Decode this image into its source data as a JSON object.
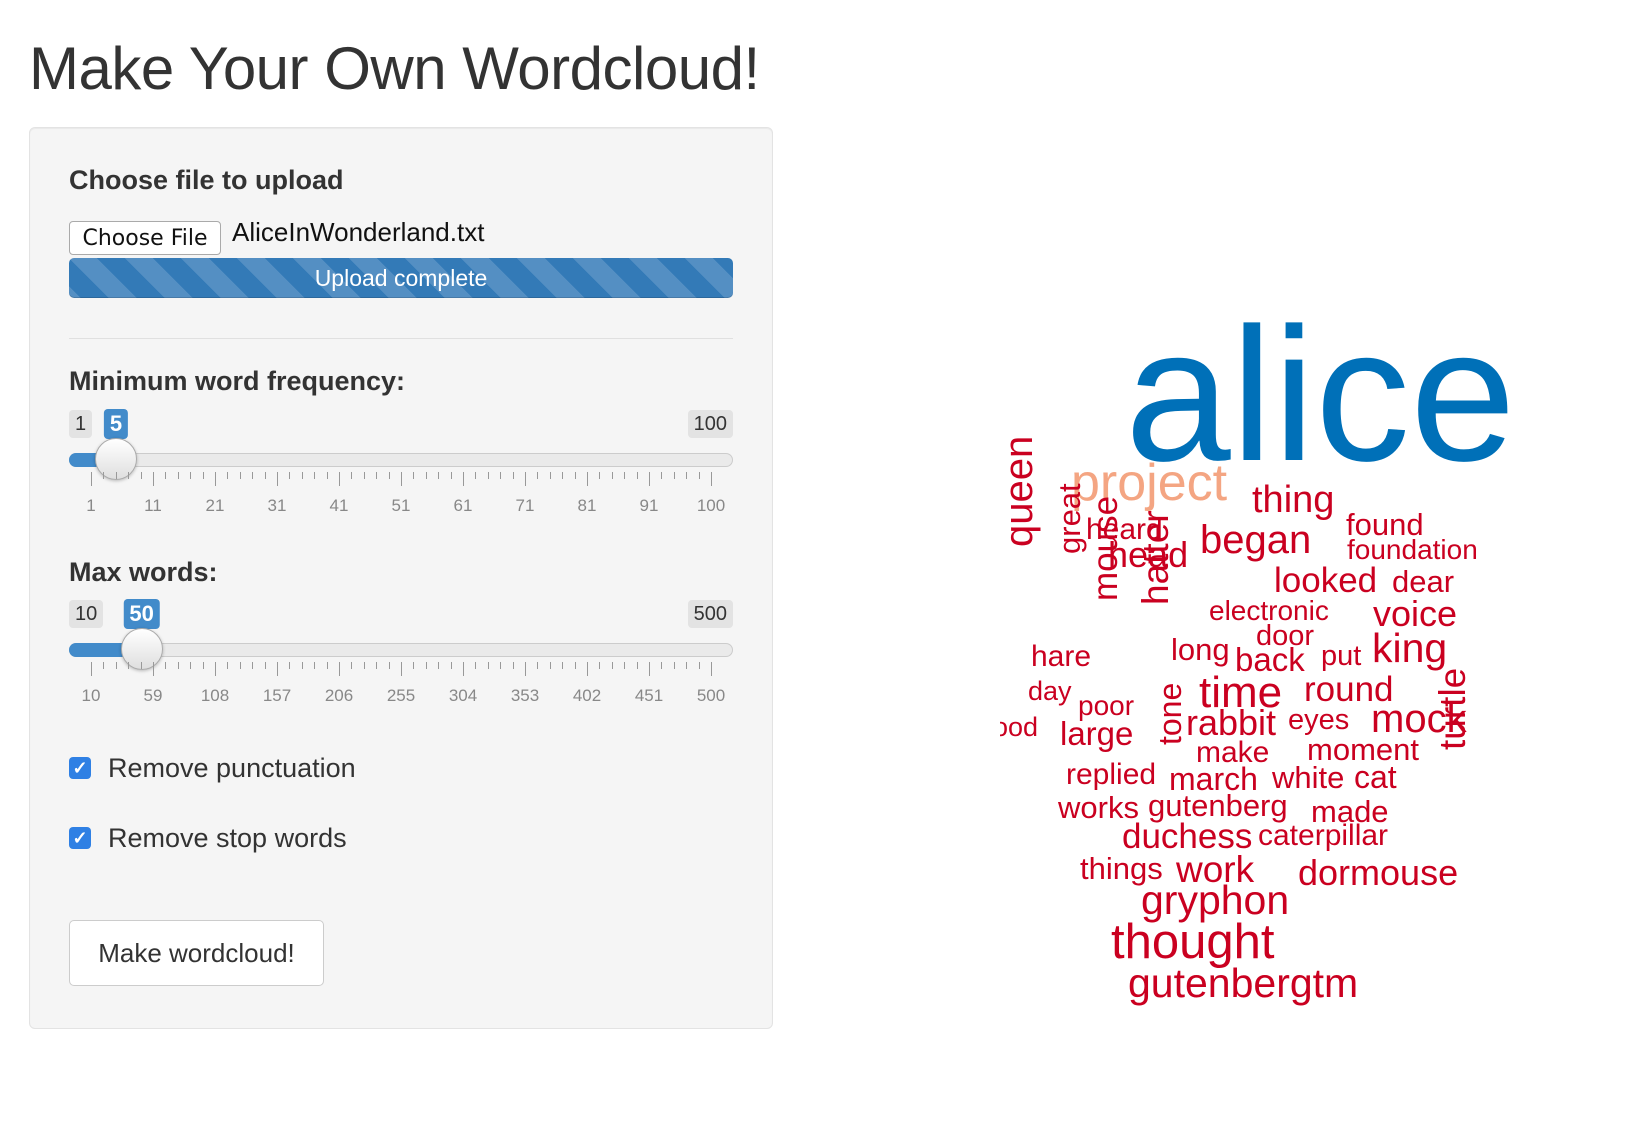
{
  "page": {
    "title": "Make Your Own Wordcloud!"
  },
  "sidebar": {
    "file_upload": {
      "label": "Choose file to upload",
      "button_label": "Choose File",
      "file_name": "AliceInWonderland.txt",
      "progress_text": "Upload complete",
      "progress": 1.0
    },
    "min_freq_slider": {
      "label": "Minimum word frequency:",
      "min_label": "1",
      "max_label": "100",
      "value_label": "5",
      "min": 1,
      "max": 100,
      "value": 5,
      "tick_labels": [
        "1",
        "11",
        "21",
        "31",
        "41",
        "51",
        "61",
        "71",
        "81",
        "91",
        "100"
      ]
    },
    "max_words_slider": {
      "label": "Max words:",
      "min_label": "10",
      "max_label": "500",
      "value_label": "50",
      "min": 10,
      "max": 500,
      "value": 50,
      "tick_labels": [
        "10",
        "59",
        "108",
        "157",
        "206",
        "255",
        "304",
        "353",
        "402",
        "451",
        "500"
      ]
    },
    "checkboxes": [
      {
        "label": "Remove punctuation",
        "checked": true
      },
      {
        "label": "Remove stop words",
        "checked": true
      }
    ],
    "submit_label": "Make wordcloud!"
  },
  "colors": {
    "accent": "#428bca",
    "progress": "#337ab7",
    "word_top": "#0070b8",
    "word_second": "#f4a582",
    "word_rest": "#ca0020"
  },
  "wordcloud": {
    "words": [
      {
        "text": "alice",
        "rank": 1,
        "rotated": false
      },
      {
        "text": "project",
        "rank": 2,
        "rotated": false
      },
      {
        "text": "thing",
        "rank": 3,
        "rotated": false
      },
      {
        "text": "queen",
        "rank": 3,
        "rotated": true
      },
      {
        "text": "found",
        "rank": 3,
        "rotated": false
      },
      {
        "text": "heard",
        "rank": 3,
        "rotated": false
      },
      {
        "text": "began",
        "rank": 3,
        "rotated": false
      },
      {
        "text": "foundation",
        "rank": 3,
        "rotated": false
      },
      {
        "text": "great",
        "rank": 3,
        "rotated": true
      },
      {
        "text": "head",
        "rank": 3,
        "rotated": false
      },
      {
        "text": "looked",
        "rank": 3,
        "rotated": false
      },
      {
        "text": "dear",
        "rank": 3,
        "rotated": false
      },
      {
        "text": "mouse",
        "rank": 3,
        "rotated": true
      },
      {
        "text": "hatter",
        "rank": 3,
        "rotated": true
      },
      {
        "text": "electronic",
        "rank": 3,
        "rotated": false
      },
      {
        "text": "voice",
        "rank": 3,
        "rotated": false
      },
      {
        "text": "door",
        "rank": 3,
        "rotated": false
      },
      {
        "text": "hare",
        "rank": 3,
        "rotated": false
      },
      {
        "text": "long",
        "rank": 3,
        "rotated": false
      },
      {
        "text": "back",
        "rank": 3,
        "rotated": false
      },
      {
        "text": "put",
        "rank": 3,
        "rotated": false
      },
      {
        "text": "king",
        "rank": 3,
        "rotated": false
      },
      {
        "text": "day",
        "rank": 3,
        "rotated": false
      },
      {
        "text": "time",
        "rank": 3,
        "rotated": false
      },
      {
        "text": "round",
        "rank": 3,
        "rotated": false
      },
      {
        "text": "poor",
        "rank": 3,
        "rotated": false
      },
      {
        "text": "tone",
        "rank": 3,
        "rotated": true
      },
      {
        "text": "good",
        "rank": 3,
        "rotated": false
      },
      {
        "text": "large",
        "rank": 3,
        "rotated": false
      },
      {
        "text": "rabbit",
        "rank": 3,
        "rotated": false
      },
      {
        "text": "eyes",
        "rank": 3,
        "rotated": false
      },
      {
        "text": "mock",
        "rank": 3,
        "rotated": false
      },
      {
        "text": "make",
        "rank": 3,
        "rotated": false
      },
      {
        "text": "moment",
        "rank": 3,
        "rotated": false
      },
      {
        "text": "replied",
        "rank": 3,
        "rotated": false
      },
      {
        "text": "march",
        "rank": 3,
        "rotated": false
      },
      {
        "text": "white",
        "rank": 3,
        "rotated": false
      },
      {
        "text": "cat",
        "rank": 3,
        "rotated": false
      },
      {
        "text": "turtle",
        "rank": 3,
        "rotated": true
      },
      {
        "text": "works",
        "rank": 3,
        "rotated": false
      },
      {
        "text": "gutenberg",
        "rank": 3,
        "rotated": false
      },
      {
        "text": "made",
        "rank": 3,
        "rotated": false
      },
      {
        "text": "duchess",
        "rank": 3,
        "rotated": false
      },
      {
        "text": "caterpillar",
        "rank": 3,
        "rotated": false
      },
      {
        "text": "things",
        "rank": 3,
        "rotated": false
      },
      {
        "text": "work",
        "rank": 3,
        "rotated": false
      },
      {
        "text": "dormouse",
        "rank": 3,
        "rotated": false
      },
      {
        "text": "gryphon",
        "rank": 3,
        "rotated": false
      },
      {
        "text": "thought",
        "rank": 3,
        "rotated": false
      },
      {
        "text": "gutenbergtm",
        "rank": 3,
        "rotated": false
      }
    ]
  }
}
